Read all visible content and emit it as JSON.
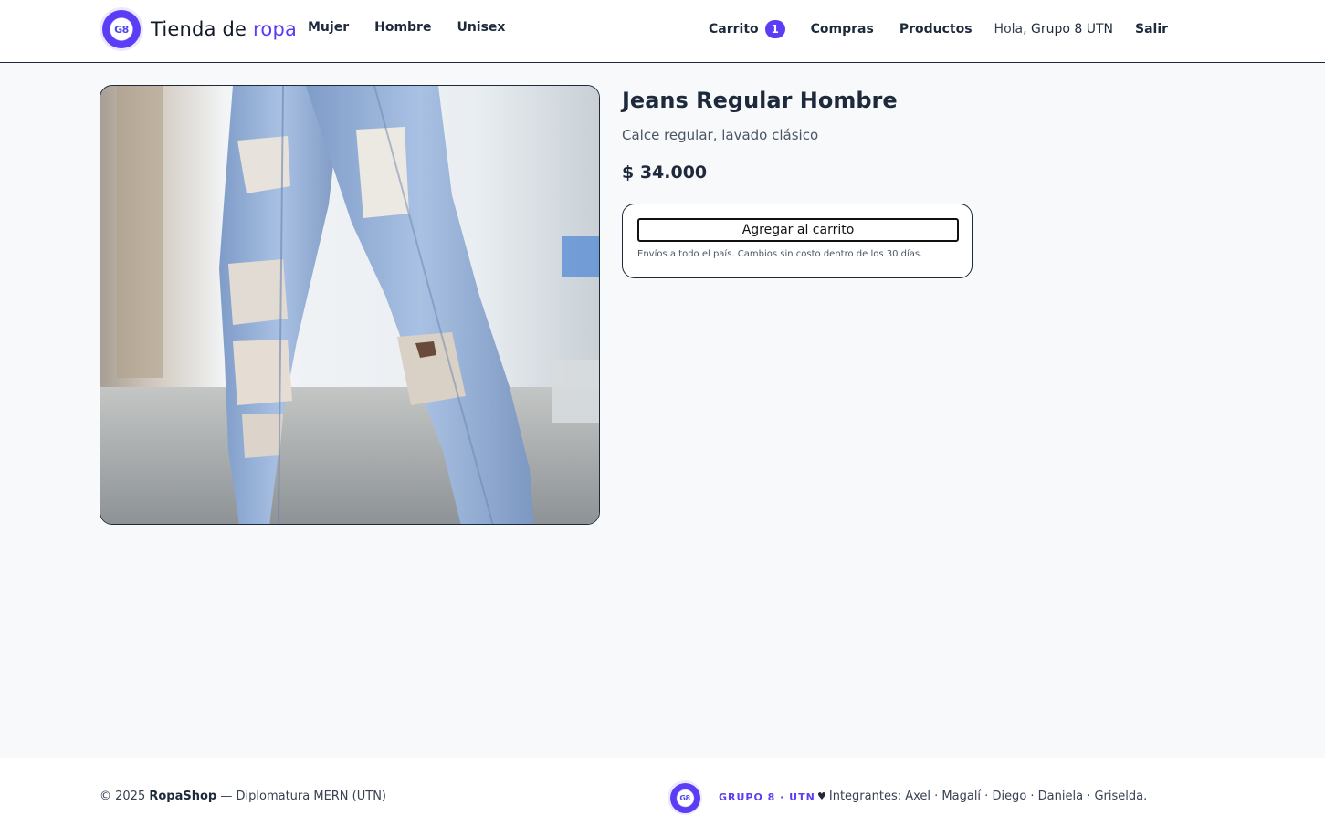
{
  "header": {
    "brand_prefix": "Tienda de ",
    "brand_accent": "ropa",
    "logo_text": "G8",
    "nav_left": [
      {
        "label": "Mujer"
      },
      {
        "label": "Hombre"
      },
      {
        "label": "Unisex"
      }
    ],
    "cart_label": "Carrito",
    "cart_count": "1",
    "compras_label": "Compras",
    "productos_label": "Productos",
    "greeting": "Hola,",
    "user_name": "Grupo 8 UTN",
    "logout_label": "Salir"
  },
  "product": {
    "image_description_icon": "jeans-photo",
    "title": "Jeans Regular Hombre",
    "subtitle": "Calce regular, lavado clásico",
    "price": "$ 34.000",
    "add_to_cart_label": "Agregar al carrito",
    "shipping_note": "Envíos a todo el país. Cambios sin costo dentro de los 30 días."
  },
  "footer": {
    "copyright_prefix": "© 2025 ",
    "copyright_brand": "RopaShop",
    "copyright_suffix": " — Diplomatura MERN (UTN)",
    "logo_text": "G8",
    "group_label": "GRUPO 8 · UTN",
    "members_icon": "heart-icon",
    "members": "Integrantes: Axel · Magalí · Diego · Daniela · Griselda."
  },
  "colors": {
    "accent": "#5b3df5",
    "background": "#f7f9fb",
    "text": "#1e2a3b"
  }
}
